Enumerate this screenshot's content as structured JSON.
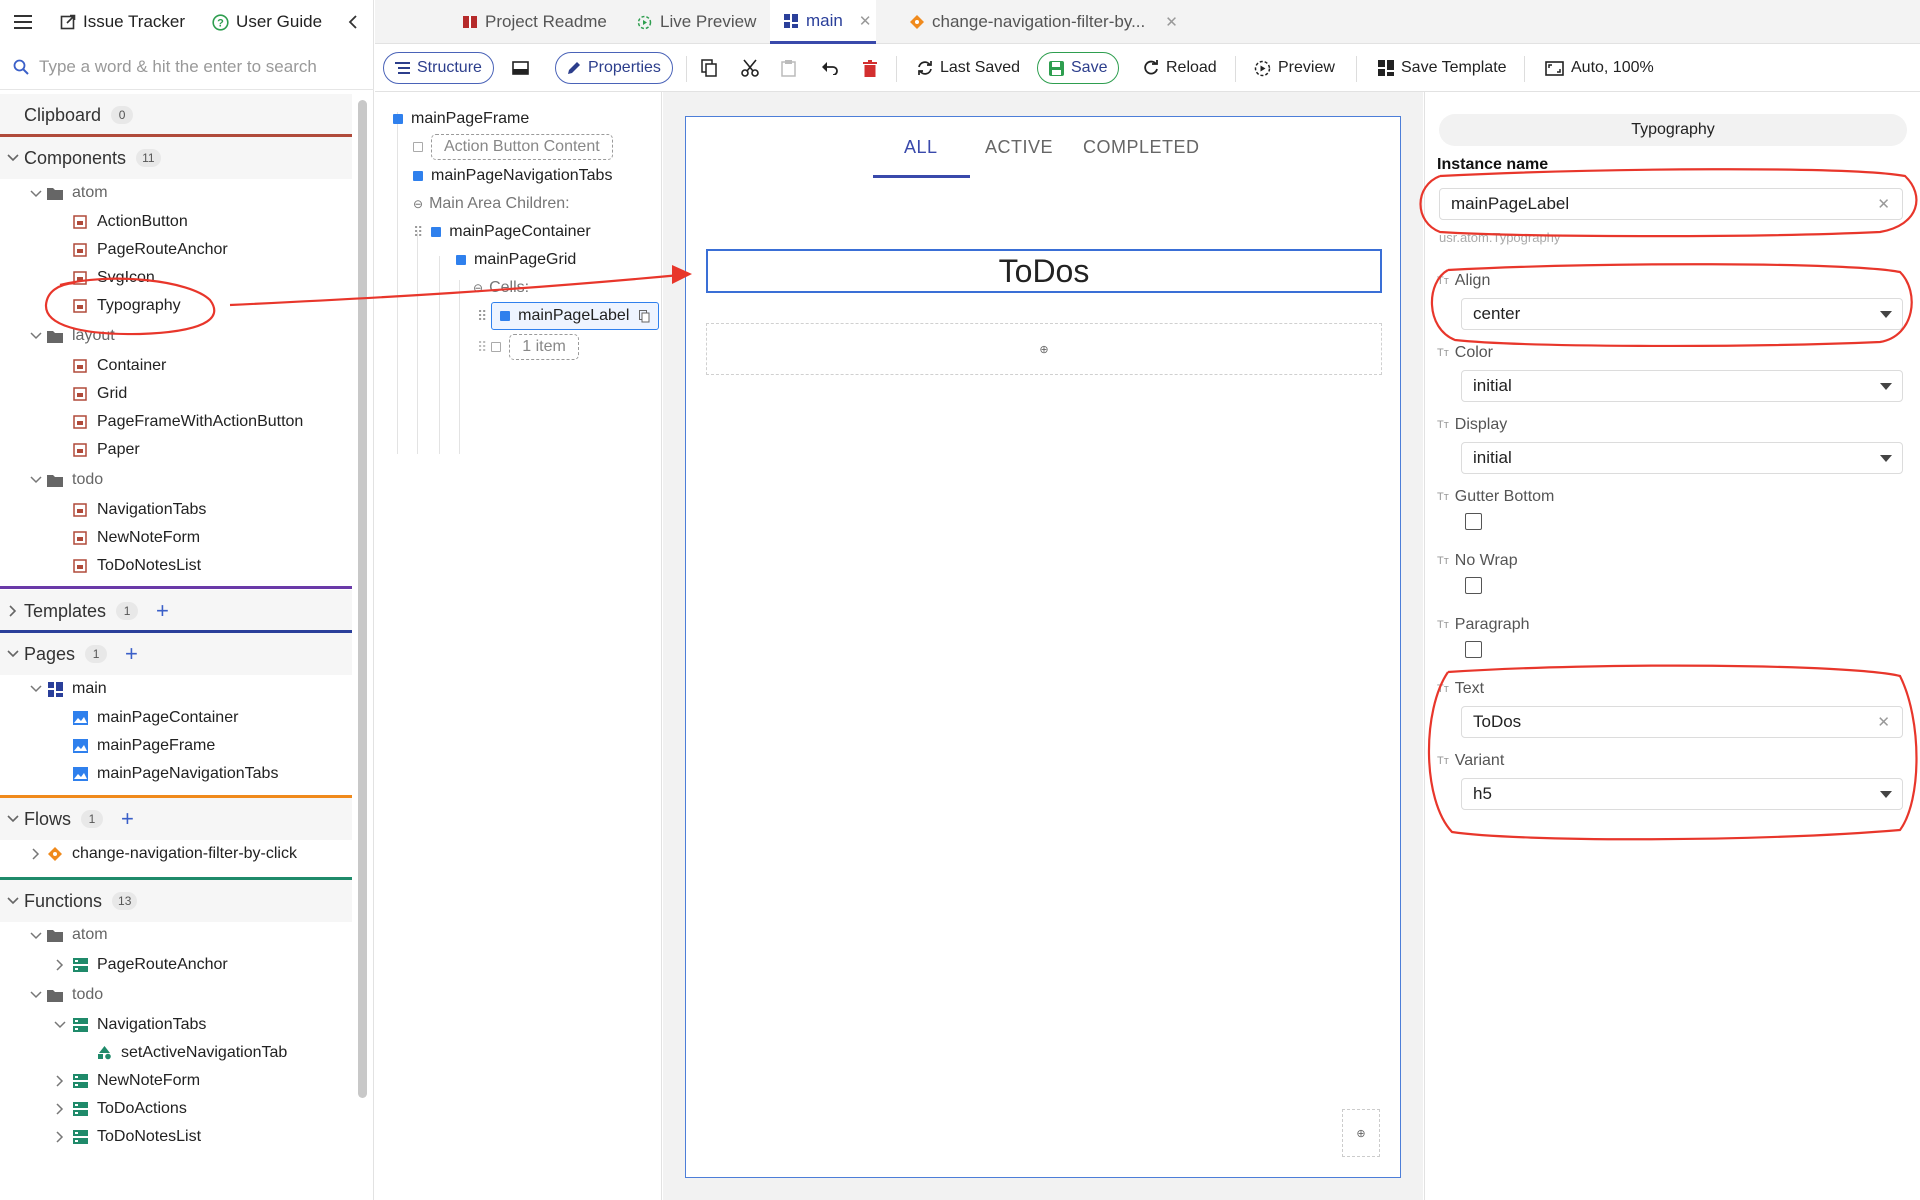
{
  "topnav": {
    "issue_tracker": "Issue Tracker",
    "user_guide": "User Guide"
  },
  "search": {
    "placeholder": "Type a word & hit the enter to search"
  },
  "sections": {
    "clipboard": {
      "label": "Clipboard",
      "count": "0"
    },
    "components": {
      "label": "Components",
      "count": "11"
    },
    "templates": {
      "label": "Templates",
      "count": "1"
    },
    "pages": {
      "label": "Pages",
      "count": "1"
    },
    "flows": {
      "label": "Flows",
      "count": "1"
    },
    "functions": {
      "label": "Functions",
      "count": "13"
    }
  },
  "components_tree": {
    "atom": "atom",
    "atom_items": [
      "ActionButton",
      "PageRouteAnchor",
      "SvgIcon",
      "Typography"
    ],
    "layout": "layout",
    "layout_items": [
      "Container",
      "Grid",
      "PageFrameWithActionButton",
      "Paper"
    ],
    "todo": "todo",
    "todo_items": [
      "NavigationTabs",
      "NewNoteForm",
      "ToDoNotesList"
    ]
  },
  "pages_tree": {
    "main": "main",
    "items": [
      "mainPageContainer",
      "mainPageFrame",
      "mainPageNavigationTabs"
    ]
  },
  "flows_tree": {
    "items": [
      "change-navigation-filter-by-click"
    ]
  },
  "functions_tree": {
    "atom": "atom",
    "atom_items": [
      "PageRouteAnchor"
    ],
    "todo": "todo",
    "navtabs": "NavigationTabs",
    "navtabs_child": "setActiveNavigationTab",
    "todo_items": [
      "NewNoteForm",
      "ToDoActions",
      "ToDoNotesList"
    ]
  },
  "tabs": {
    "readme": "Project Readme",
    "live_preview": "Live Preview",
    "main": "main",
    "flow": "change-navigation-filter-by..."
  },
  "toolbar": {
    "structure": "Structure",
    "properties": "Properties",
    "last_saved": "Last Saved",
    "save": "Save",
    "reload": "Reload",
    "preview": "Preview",
    "save_template": "Save Template",
    "zoom": "Auto, 100%"
  },
  "structure_tree": {
    "root": "mainPageFrame",
    "action_button_content": "Action Button Content",
    "nav_tabs": "mainPageNavigationTabs",
    "main_area_children": "Main Area Children:",
    "container": "mainPageContainer",
    "grid": "mainPageGrid",
    "cells": "Cells:",
    "label": "mainPageLabel",
    "one_item": "1 item"
  },
  "canvas": {
    "tabs": [
      "ALL",
      "ACTIVE",
      "COMPLETED"
    ],
    "label_text": "ToDos",
    "dropzone_icon": "⊕",
    "corner_icon": "⊕"
  },
  "properties": {
    "header": "Typography",
    "instance_name_label": "Instance name",
    "instance_name_value": "mainPageLabel",
    "component_path": "usr.atom.Typography",
    "align_label": "Align",
    "align_value": "center",
    "color_label": "Color",
    "color_value": "initial",
    "display_label": "Display",
    "display_value": "initial",
    "gutter_bottom_label": "Gutter Bottom",
    "no_wrap_label": "No Wrap",
    "paragraph_label": "Paragraph",
    "text_label": "Text",
    "text_value": "ToDos",
    "variant_label": "Variant",
    "variant_value": "h5"
  },
  "colors": {
    "accent_blue": "#2f80ed",
    "tab_indicator": "#3949ab",
    "annotation_red": "#e8362b",
    "save_green": "#2e9e4f",
    "components_line": "#b04a3a",
    "templates_line": "#6a3aa8",
    "pages_line": "#2a3f9a",
    "flows_line": "#f08a1c",
    "functions_line": "#1f8a6a"
  }
}
